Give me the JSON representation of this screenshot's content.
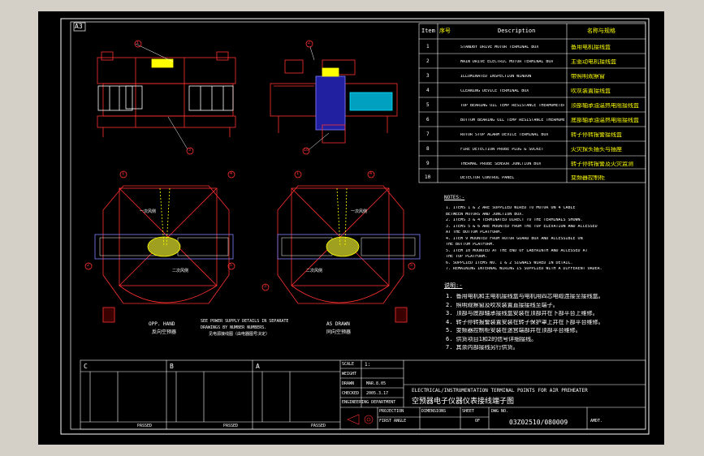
{
  "sheet": {
    "size": "A3"
  },
  "parts_table": {
    "headers": {
      "item": "Item",
      "item_cn": "序号",
      "description": "Description",
      "name_cn": "名称与规格"
    },
    "rows": [
      {
        "no": "1",
        "desc": "STANDBY DRIVE MOTOR TERMINAL BOX",
        "cn": "备用电机接线盒"
      },
      {
        "no": "2",
        "desc": "MAIN DRIVE ELECTRIC MOTOR TERMINAL BOX",
        "cn": "主驱动电机接线盒"
      },
      {
        "no": "3",
        "desc": "ILLUMINATED INSPECTION WINDOW",
        "cn": "带照明观察窗"
      },
      {
        "no": "4",
        "desc": "CLEANING DEVICE TERMINAL BOX",
        "cn": "吹灰装置接线盒"
      },
      {
        "no": "5",
        "desc": "TOP BEARING OIL TEMP RESISTANCE THERMOMETER JUNCTION BOX",
        "cn": "顶部轴承油温热电阻接线盒"
      },
      {
        "no": "6",
        "desc": "BOTTOM BEARING OIL TEMP RESISTANCE THERMOMETER JUNCTION BOX",
        "cn": "底部轴承油温热电阻接线盒"
      },
      {
        "no": "7",
        "desc": "ROTOR STOP ALARM DEVICE TERMINAL BOX",
        "cn": "转子停转报警接线盒"
      },
      {
        "no": "8",
        "desc": "FIRE DETECTION PROBE PLUG & SOCKET",
        "cn": "火灾探头插头与插座"
      },
      {
        "no": "9",
        "desc": "THERMAL PROBE SENSOR JUNCTION BOX",
        "cn": "转子停转报警及火灾监测"
      },
      {
        "no": "10",
        "desc": "DETECTOR CONTROL PANEL",
        "cn": "变频器控制柜"
      }
    ]
  },
  "notes_en": {
    "title": "NOTES:-",
    "lines": [
      "1. ITEMS 1 & 2 ARE SUPPLIED WIRED TO MOTOR ON 4 CABLE",
      "   BETWEEN MOTORS AND JUNCTION BOX.",
      "2. ITEMS 3 & 4 TERMINATED DIRECT TO THE TERMINALS SHOWN.",
      "3. ITEMS 5 & 6 ARE MOUNTED FROM THE TOP ELEVATION AND ACCESSED",
      "   AT THE BOTTOM PLATFORM.",
      "4. ITEM 9 MOUNTED FROM ROTOR GUARD BOX AND ACCESSIBLE ON",
      "   THE BOTTOM PLATFORM.",
      "5. ITEM 10 MOUNTED AT THE END OF LABYRINTH AND ACCESSED AT",
      "   THE TOP PLATFORM.",
      "6. SUPPLIED ITEMS NO. 1 & 2 SIGNALS WIRED IN DETAIL.",
      "7. REMAINING INTERNAL WIRING IS SUPPLIED WITH A DIFFERENT ORDER."
    ]
  },
  "notes_cn": {
    "title": "说明:-",
    "lines": [
      "1. 备用电机和主电机接线盒与电机用四芯电缆连接至接线盒。",
      "2. 照明观察窗及吹灰装置直接接线至端子。",
      "3. 顶部与底部轴承接线盒安装在顶部并在下部平台上维修。",
      "4. 转子停转报警装置安装在转子保护罩上并在下部平台维修。",
      "5. 变频器控制柜安装在迷宫端部并在顶部平台维修。",
      "6. 供货项目1和2的信号详细接线。",
      "7. 其余内部接线另行供货。"
    ]
  },
  "views": {
    "left_label_en": "OPP. HAND",
    "left_label_cn": "反向空预器",
    "right_label_en": "AS DRAWN",
    "right_label_cn": "同向空预器",
    "center_note_en_1": "SEE POWER SUPPLY DETAILS IN SEPARATE",
    "center_note_en_2": "DRAWINGS BY NUMBER NUMBERS.",
    "center_note_cn": "见电源接线图（由电器图号决定）",
    "inner_label_left": "二次风侧",
    "inner_label_right": "二次风侧",
    "side_left": "一次风侧",
    "side_right": "一次风侧"
  },
  "callouts": [
    "1",
    "2",
    "3",
    "4",
    "5",
    "6",
    "7",
    "8",
    "9",
    "10"
  ],
  "title_block": {
    "zone_c": "C",
    "zone_b": "B",
    "zone_a": "A",
    "scale_label": "SCALE",
    "scale_value": "1:",
    "weight_label": "WEIGHT",
    "title_en": "ELECTRICAL/INSTRUMENTATION TERMINAL POINTS FOR AIR PREHEATER",
    "title_cn": "空预器电子仪器仪表接线端子图",
    "drawing_no": "03Z02510/080009",
    "sheet_label": "SHEET",
    "sheet_of": "OF",
    "date1": "MAR.8.05",
    "date2": "2005.3.17",
    "drawn_label": "DRAWN",
    "checked_label": "CHECKED",
    "approved_label": "APPROVED",
    "dept": "ENGINEERING DEPARTMENT",
    "passed": "PASSED",
    "amdt": "AMDT.",
    "dwg_no_label": "DWG NO.",
    "projection": "PROJECTION",
    "first_angle": "FIRST ANGLE",
    "dimensions": "DIMENSIONS",
    "date_label": "DATE"
  },
  "colors": {
    "background": "#000000",
    "frame": "#ffffff",
    "structure": "#ff3030",
    "text": "#ffff00",
    "rotor": "#8080ff",
    "accent": "#00e5ff"
  }
}
